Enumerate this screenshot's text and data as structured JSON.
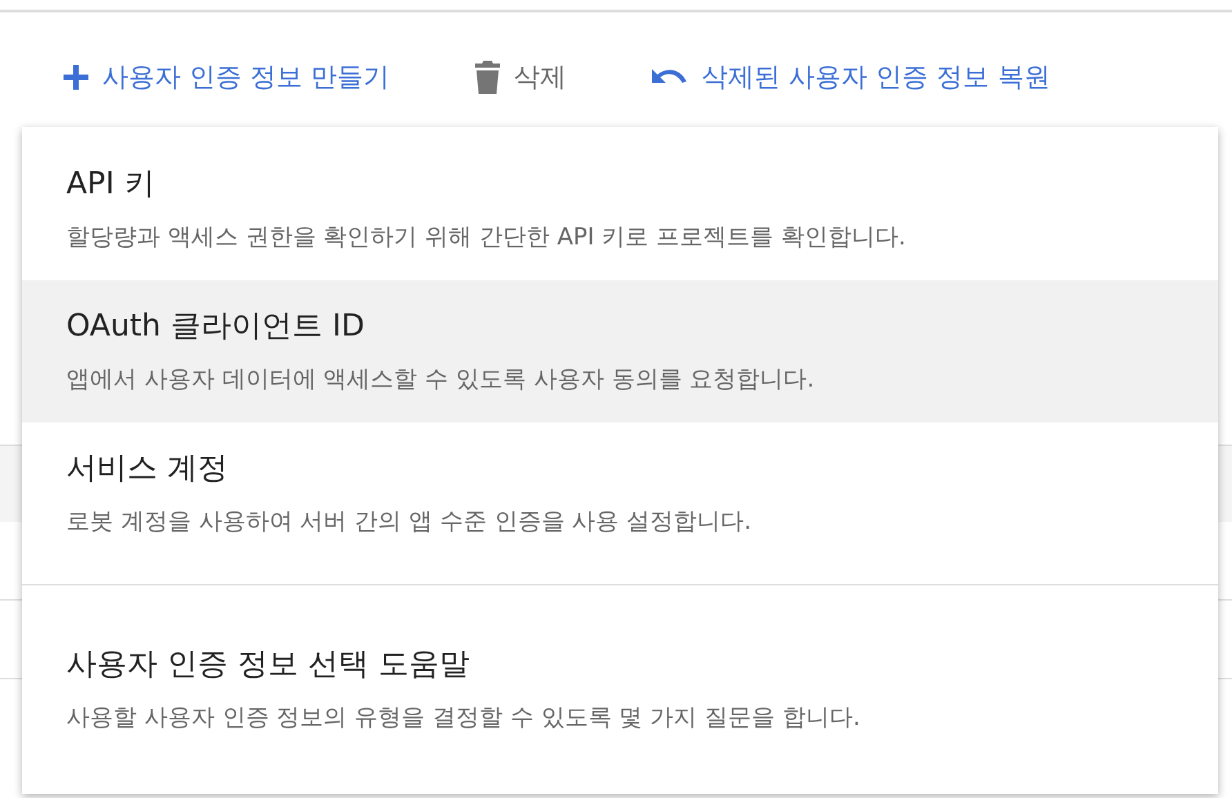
{
  "toolbar": [
    {
      "kind": "create",
      "label": "사용자 인증 정보 만들기"
    },
    {
      "kind": "delete",
      "label": "삭제"
    },
    {
      "kind": "restore",
      "label": "삭제된 사용자 인증 정보 복원"
    }
  ],
  "menu": {
    "items": [
      {
        "title": "API 키",
        "description": "할당량과 액세스 권한을 확인하기 위해 간단한 API 키로 프로젝트를 확인합니다.",
        "selected": false
      },
      {
        "title": "OAuth 클라이언트 ID",
        "description": "앱에서 사용자 데이터에 액세스할 수 있도록 사용자 동의를 요청합니다.",
        "selected": true
      },
      {
        "title": "서비스 계정",
        "description": "로봇 계정을 사용하여 서버 간의 앱 수준 인증을 사용 설정합니다.",
        "selected": false
      }
    ],
    "help": {
      "title": "사용자 인증 정보 선택 도움말",
      "description": "사용할 사용자 인증 정보의 유형을 결정할 수 있도록 몇 가지 질문을 합니다."
    }
  }
}
